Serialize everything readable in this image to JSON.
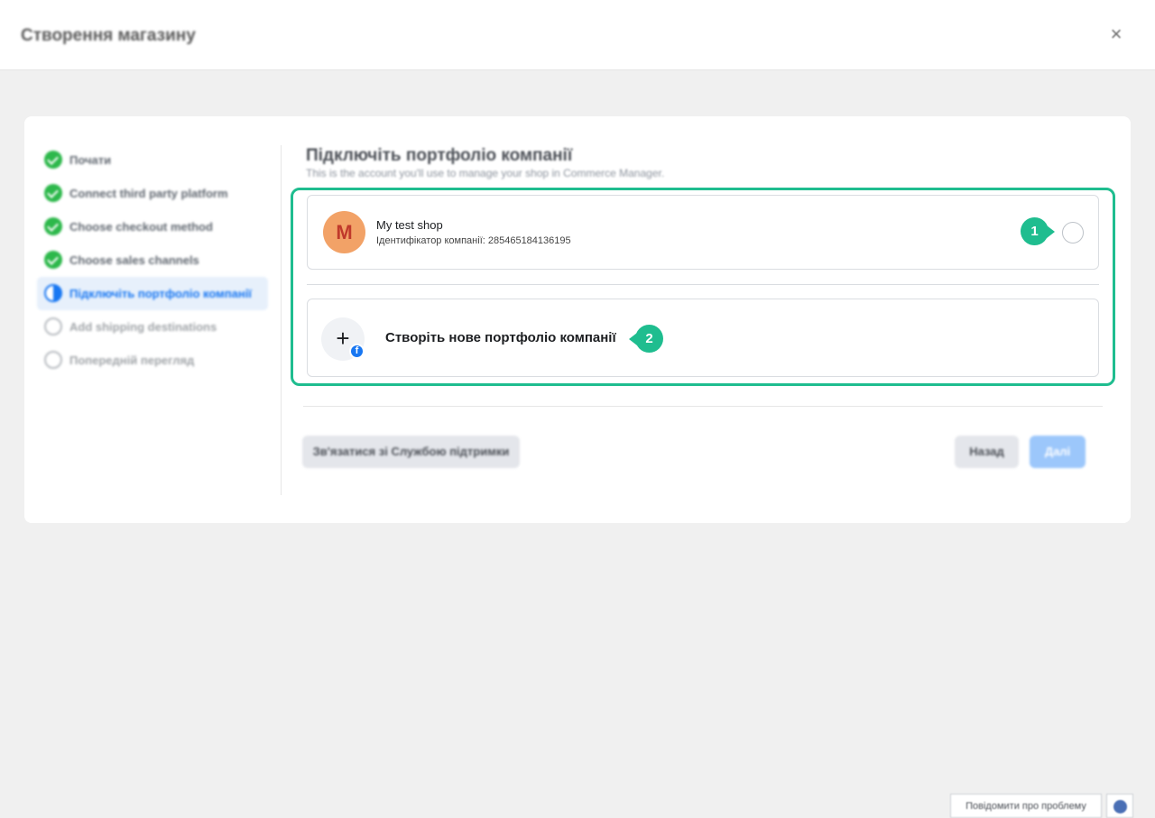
{
  "header": {
    "title": "Створення магазину",
    "close_glyph": "×"
  },
  "steps": [
    {
      "label": "Почати",
      "status": "done"
    },
    {
      "label": "Connect third party platform",
      "status": "done"
    },
    {
      "label": "Choose checkout method",
      "status": "done"
    },
    {
      "label": "Choose sales channels",
      "status": "done"
    },
    {
      "label": "Підключіть портфоліо компанії",
      "status": "current"
    },
    {
      "label": "Add shipping destinations",
      "status": "todo"
    },
    {
      "label": "Попередній перегляд",
      "status": "todo"
    }
  ],
  "main": {
    "heading": "Підключіть портфоліо компанії",
    "subheading": "This is the account you'll use to manage your shop in Commerce Manager.",
    "existing_portfolio": {
      "avatar_letter": "M",
      "name": "My test shop",
      "id_line": "Ідентифікатор компанії: 285465184136195"
    },
    "create_option": {
      "label": "Створіть нове портфоліо компанії",
      "plus_glyph": "+",
      "badge_glyph": "f"
    }
  },
  "annotations": {
    "marker_1": "1",
    "marker_2": "2",
    "color": "#1fbd8f"
  },
  "footer": {
    "support_label": "Зв'язатися зі Службою підтримки",
    "back_label": "Назад",
    "next_label": "Далі"
  },
  "page_footer": {
    "report_label": "Повідомити про проблему"
  },
  "colors": {
    "accent": "#1877f2",
    "done": "#2db84b",
    "highlight": "#1fbd8f"
  }
}
